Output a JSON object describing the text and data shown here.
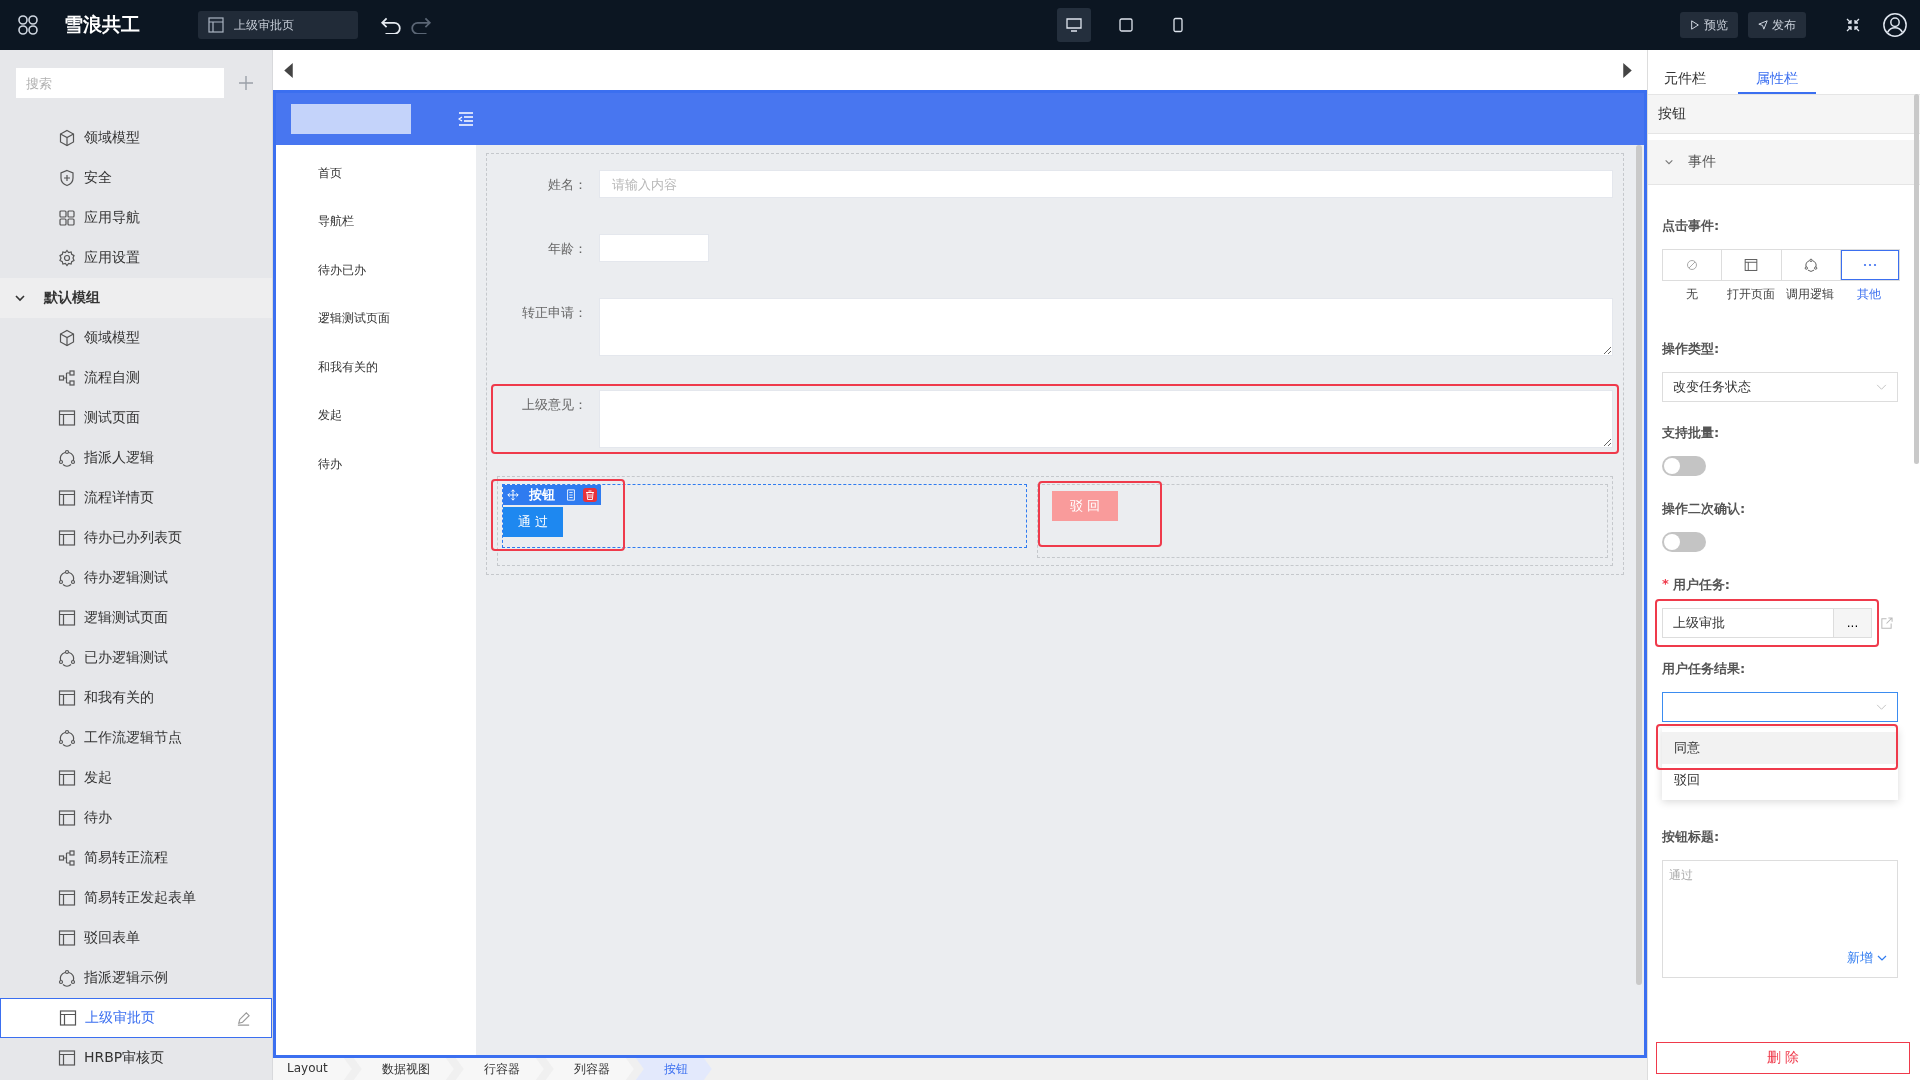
{
  "topbar": {
    "app_name": "雪浪共工",
    "page_tab": "上级审批页",
    "devices": [
      {
        "kind": "desktop",
        "selected": true
      },
      {
        "kind": "tablet",
        "selected": false
      },
      {
        "kind": "phone",
        "selected": false
      }
    ],
    "buttons": [
      {
        "kind": "preview",
        "label": "预览"
      },
      {
        "kind": "publish",
        "label": "发布"
      }
    ]
  },
  "sidebar": {
    "search": {
      "placeholder": "搜索"
    },
    "items": [
      {
        "label": "领域模型",
        "kind": "cube",
        "selected": false
      },
      {
        "label": "安全",
        "kind": "shield",
        "selected": false
      },
      {
        "label": "应用导航",
        "kind": "grid",
        "selected": false
      },
      {
        "label": "应用设置",
        "kind": "gear",
        "selected": false
      },
      {
        "label": "默认模组",
        "kind": "group",
        "expanded": true,
        "children": [
          {
            "label": "领域模型",
            "kind": "cube",
            "selected": false
          },
          {
            "label": "流程自测",
            "kind": "flow",
            "selected": false
          },
          {
            "label": "测试页面",
            "kind": "page",
            "selected": false
          },
          {
            "label": "指派人逻辑",
            "kind": "logic",
            "selected": false
          },
          {
            "label": "流程详情页",
            "kind": "page",
            "selected": false
          },
          {
            "label": "待办已办列表页",
            "kind": "page",
            "selected": false
          },
          {
            "label": "待办逻辑测试",
            "kind": "logic",
            "selected": false
          },
          {
            "label": "逻辑测试页面",
            "kind": "page",
            "selected": false
          },
          {
            "label": "已办逻辑测试",
            "kind": "logic",
            "selected": false
          },
          {
            "label": "和我有关的",
            "kind": "page",
            "selected": false
          },
          {
            "label": "工作流逻辑节点",
            "kind": "logic",
            "selected": false
          },
          {
            "label": "发起",
            "kind": "page",
            "selected": false
          },
          {
            "label": "待办",
            "kind": "page",
            "selected": false
          },
          {
            "label": "简易转正流程",
            "kind": "flow",
            "selected": false
          },
          {
            "label": "简易转正发起表单",
            "kind": "page",
            "selected": false
          },
          {
            "label": "驳回表单",
            "kind": "page",
            "selected": false
          },
          {
            "label": "指派逻辑示例",
            "kind": "logic",
            "selected": false
          },
          {
            "label": "上级审批页",
            "kind": "page",
            "selected": true
          },
          {
            "label": "HRBP审核页",
            "kind": "page",
            "selected": false
          }
        ]
      }
    ]
  },
  "canvas": {
    "app_nav": [
      "首页",
      "导航栏",
      "待办已办",
      "逻辑测试页面",
      "和我有关的",
      "发起",
      "待办"
    ],
    "form": {
      "fields": [
        {
          "label": "姓名：",
          "kind": "input",
          "placeholder": "请输入内容",
          "annotated": false
        },
        {
          "label": "年龄：",
          "kind": "short-input",
          "annotated": false
        },
        {
          "label": "转正申请：",
          "kind": "textarea",
          "annotated": false
        },
        {
          "label": "上级意见：",
          "kind": "textarea",
          "annotated": true
        }
      ],
      "toolbar_label": "按钮",
      "buttons": [
        {
          "kind": "primary",
          "label": "通 过",
          "annotated": true
        },
        {
          "kind": "danger",
          "label": "驳 回",
          "annotated": true
        }
      ]
    }
  },
  "breadcrumb": [
    {
      "label": "Layout",
      "selected": false
    },
    {
      "label": "数据视图",
      "selected": false
    },
    {
      "label": "行容器",
      "selected": false
    },
    {
      "label": "列容器",
      "selected": false
    },
    {
      "label": "按钮",
      "selected": true
    }
  ],
  "properties": {
    "tabs": [
      {
        "label": "元件栏",
        "selected": false
      },
      {
        "label": "属性栏",
        "selected": true
      }
    ],
    "title": "按钮",
    "section": {
      "title": "事件",
      "expanded": true
    },
    "click_event": {
      "label": "点击事件:",
      "options": [
        {
          "kind": "none",
          "label": "无",
          "selected": false
        },
        {
          "kind": "page",
          "label": "打开页面",
          "selected": false
        },
        {
          "kind": "logic",
          "label": "调用逻辑",
          "selected": false
        },
        {
          "kind": "more",
          "label": "其他",
          "selected": true
        }
      ]
    },
    "operation_type": {
      "label": "操作类型:",
      "value": "改变任务状态"
    },
    "batch": {
      "label": "支持批量:",
      "on": false
    },
    "confirm": {
      "label": "操作二次确认:",
      "on": false
    },
    "user_task": {
      "label": "用户任务:",
      "required_mark": "*",
      "value": "上级审批",
      "button": "...",
      "annotated": true
    },
    "task_result": {
      "label": "用户任务结果:",
      "options": [
        {
          "label": "同意",
          "hovered": true,
          "annotated": true
        },
        {
          "label": "驳回",
          "hovered": false,
          "annotated": false
        }
      ]
    },
    "button_title": {
      "label": "按钮标题:",
      "placeholder": "通过",
      "add_link": "新增"
    },
    "delete_button": "删 除"
  }
}
